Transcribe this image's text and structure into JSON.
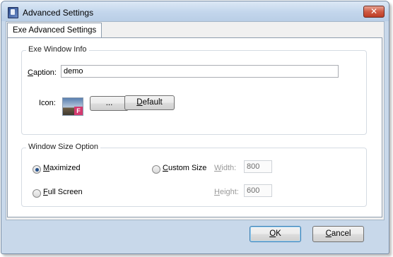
{
  "window": {
    "title": "Advanced Settings",
    "close_glyph": "✕"
  },
  "tab": {
    "label": "Exe Advanced Settings"
  },
  "exe_window_info": {
    "legend": "Exe Window Info",
    "caption": {
      "label": "Caption:",
      "value": "demo"
    },
    "icon": {
      "label": "Icon:",
      "badge": "F",
      "browse_label": "...",
      "default_label": "Default"
    }
  },
  "window_size_option": {
    "legend": "Window Size Option",
    "maximized_label": "Maximized",
    "full_screen_label": "Full Screen",
    "custom_size_label": "Custom Size",
    "width": {
      "label": "Width:",
      "value": "800"
    },
    "height": {
      "label": "Height:",
      "value": "600"
    },
    "selected": "Maximized"
  },
  "footer": {
    "ok_label": "OK",
    "cancel_label": "Cancel"
  }
}
